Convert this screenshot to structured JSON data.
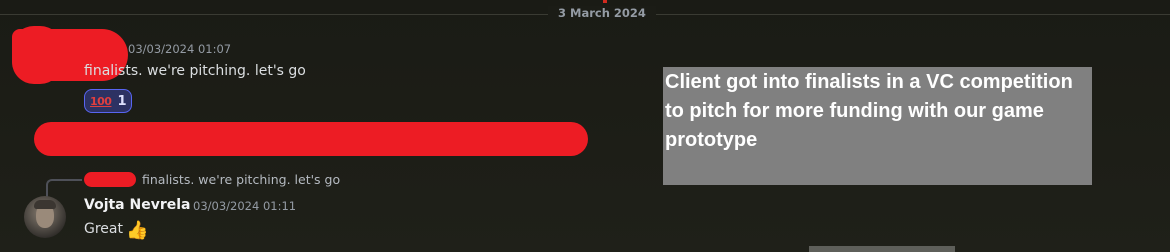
{
  "date_divider": "3 March 2024",
  "messages": [
    {
      "timestamp": "03/03/2024 01:07",
      "text": "finalists. we're pitching. let's go",
      "reaction": {
        "emoji": "100-icon",
        "emoji_text": "100",
        "count": "1"
      }
    },
    {
      "reply_preview": "finalists. we're pitching. let's go",
      "author": "Vojta Nevrela",
      "timestamp": "03/03/2024 01:11",
      "text": "Great",
      "emoji": "thumbs-up-icon"
    }
  ],
  "overlay_caption": "Client got into finalists in a VC competition to pitch for more funding with our game prototype",
  "colors": {
    "redaction": "#ed1c24",
    "overlay": "#808080",
    "reaction_border": "#5865f2"
  }
}
